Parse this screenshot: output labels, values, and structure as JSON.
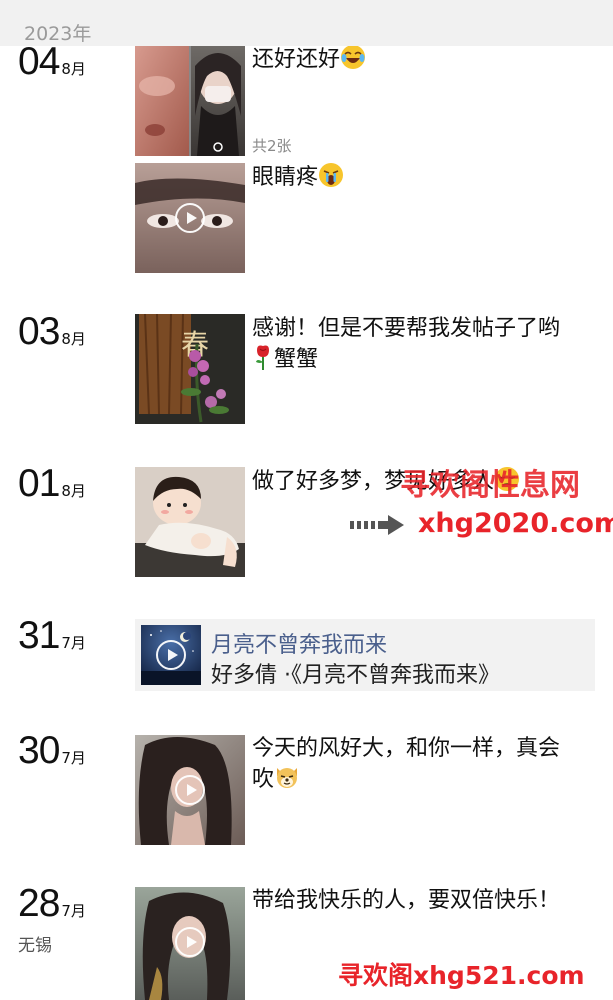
{
  "header": {
    "year": "2023年"
  },
  "posts": [
    {
      "day": "04",
      "month": "8月",
      "entries": [
        {
          "caption": "还好还好",
          "emoji": "laughing-tears-emoji",
          "photo_count": "共2张"
        },
        {
          "caption": "眼睛疼",
          "emoji": "crying-emoji"
        }
      ]
    },
    {
      "day": "03",
      "month": "8月",
      "caption_line1": "感谢！但是不要帮我发帖子了哟",
      "caption_line2": "蟹蟹",
      "emoji": "rose-emoji"
    },
    {
      "day": "01",
      "month": "8月",
      "caption": "做了好多梦，梦见好多人",
      "emoji": "sleepy-emoji"
    },
    {
      "day": "31",
      "month": "7月",
      "music_title": "月亮不曾奔我而来",
      "music_artist": "好多倩 ·《月亮不曾奔我而来》"
    },
    {
      "day": "30",
      "month": "7月",
      "caption_line1": "今天的风好大，和你一样，真会",
      "caption_line2": "吹",
      "emoji": "dog-emoji"
    },
    {
      "day": "28",
      "month": "7月",
      "location": "无锡",
      "caption": "带给我快乐的人，要双倍快乐！"
    }
  ],
  "watermarks": {
    "top_text": "寻欢阁性息网",
    "top_url": "xhg2020.com",
    "bottom": "寻欢阁xhg521.com"
  },
  "colors": {
    "header_bg": "#f1f1f1",
    "music_card_bg": "#f2f2f2",
    "music_title": "#4a5f8c",
    "watermark_red": "#e8242a"
  }
}
